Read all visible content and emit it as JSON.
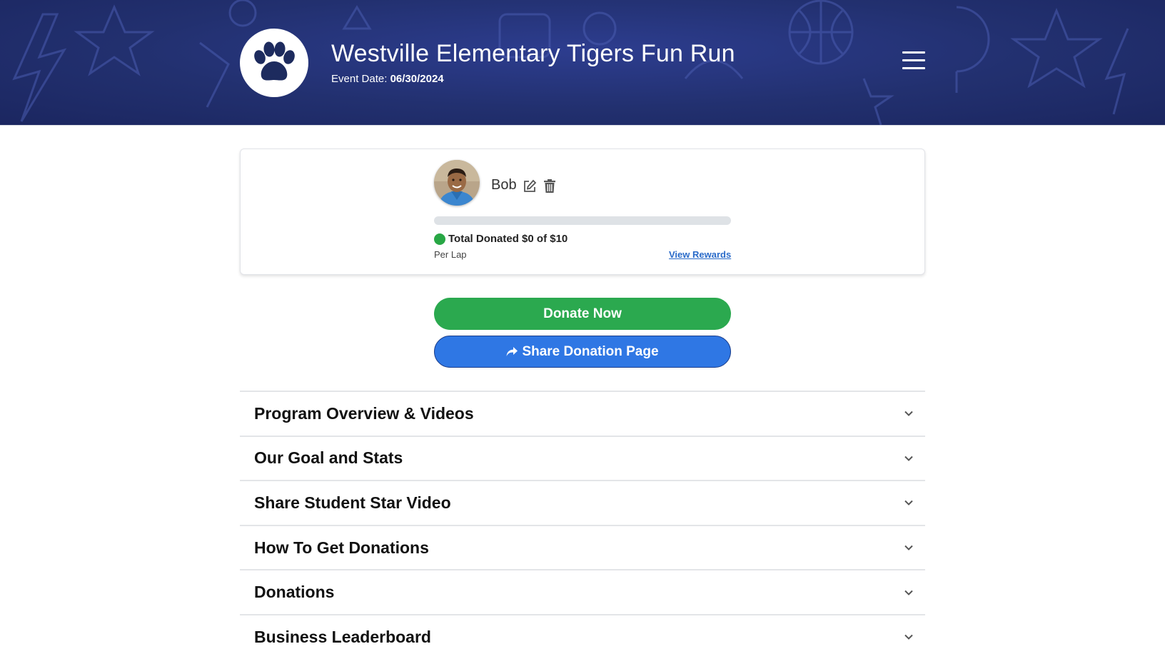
{
  "header": {
    "title": "Westville Elementary Tigers Fun Run",
    "event_date_label": "Event Date:",
    "event_date": "06/30/2024",
    "logo_icon": "paw-icon",
    "menu_icon": "hamburger-menu-icon",
    "background_color": "#22306f"
  },
  "student": {
    "name": "Bob",
    "edit_icon": "edit-icon",
    "delete_icon": "trash-icon",
    "progress_fraction": 0,
    "total_donated_text": "Total Donated $0 of $10",
    "per_lap_label": "Per Lap",
    "view_rewards_label": "View Rewards"
  },
  "actions": {
    "donate_label": "Donate Now",
    "share_label": "Share Donation Page",
    "share_icon": "share-arrow-icon",
    "donate_color": "#2ba94f",
    "share_color": "#2f77e4"
  },
  "accordion": {
    "items": [
      {
        "label": "Program Overview & Videos"
      },
      {
        "label": "Our Goal and Stats"
      },
      {
        "label": "Share Student Star Video"
      },
      {
        "label": "How To Get Donations"
      },
      {
        "label": "Donations"
      },
      {
        "label": "Business Leaderboard"
      }
    ],
    "chevron_icon": "chevron-down-icon"
  }
}
